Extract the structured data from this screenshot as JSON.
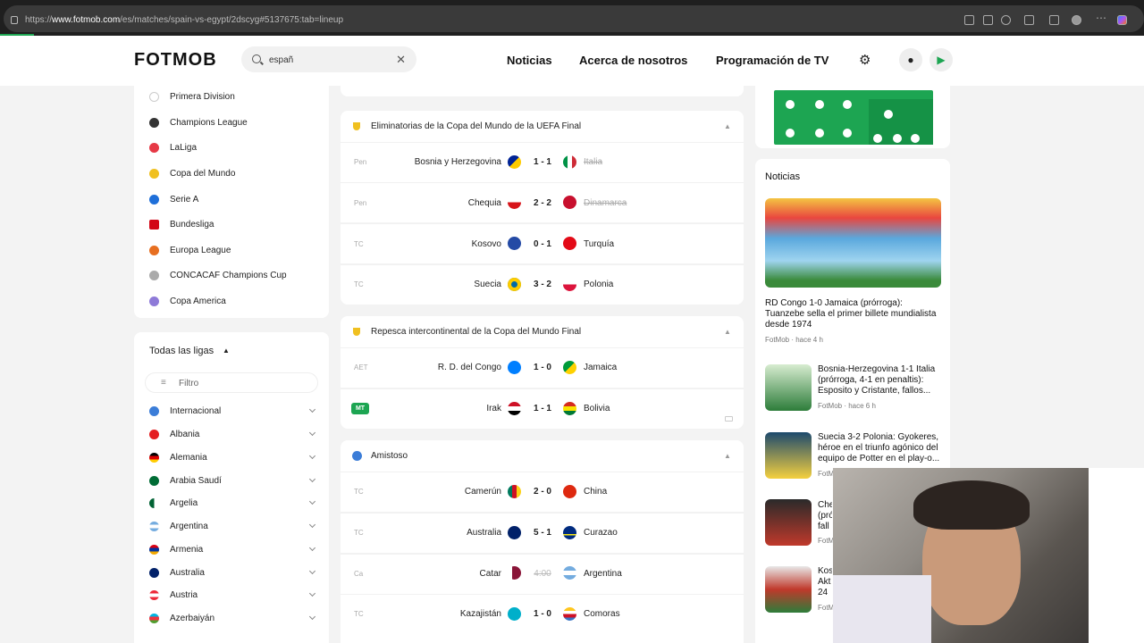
{
  "browser": {
    "url_prefix": "https://",
    "url_domain": "www.fotmob.com",
    "url_path": "/es/matches/spain-vs-egypt/2dscyg#5137675:tab=lineup"
  },
  "header": {
    "logo": "FOTMOB",
    "search_value": "españ",
    "nav": [
      "Noticias",
      "Acerca de nosotros",
      "Programación de TV"
    ]
  },
  "sidebar": {
    "leagues": [
      "Primera Division",
      "Champions League",
      "LaLiga",
      "Copa del Mundo",
      "Serie A",
      "Bundesliga",
      "Europa League",
      "CONCACAF Champions Cup",
      "Copa America"
    ],
    "all_title": "Todas las ligas",
    "filter_placeholder": "Filtro",
    "countries": [
      "Internacional",
      "Albania",
      "Alemania",
      "Arabia Saudí",
      "Argelia",
      "Argentina",
      "Armenia",
      "Australia",
      "Austria",
      "Azerbaiyán"
    ]
  },
  "sections": [
    {
      "title": "Eliminatorias de la Copa del Mundo de la UEFA Final",
      "matches": [
        {
          "status": "Pen",
          "home": "Bosnia y Herzegovina",
          "score": "1 - 1",
          "away": "Italia",
          "away_loser": true
        },
        {
          "status": "Pen",
          "home": "Chequia",
          "score": "2 - 2",
          "away": "Dinamarca",
          "away_loser": true
        },
        {
          "status": "TC",
          "home": "Kosovo",
          "score": "0 - 1",
          "away": "Turquía"
        },
        {
          "status": "TC",
          "home": "Suecia",
          "score": "3 - 2",
          "away": "Polonia"
        }
      ]
    },
    {
      "title": "Repesca intercontinental de la Copa del Mundo Final",
      "matches": [
        {
          "status": "AET",
          "home": "R. D. del Congo",
          "score": "1 - 0",
          "away": "Jamaica"
        },
        {
          "status": "MT",
          "home": "Irak",
          "score": "1 - 1",
          "away": "Bolivia",
          "live": true
        }
      ]
    },
    {
      "title": "Amistoso",
      "matches": [
        {
          "status": "TC",
          "home": "Camerún",
          "score": "2 - 0",
          "away": "China"
        },
        {
          "status": "TC",
          "home": "Australia",
          "score": "5 - 1",
          "away": "Curazao"
        },
        {
          "status": "Ca",
          "home": "Catar",
          "score": "4:00",
          "away": "Argentina",
          "cancelled": true
        },
        {
          "status": "TC",
          "home": "Kazajistán",
          "score": "1 - 0",
          "away": "Comoras"
        }
      ]
    }
  ],
  "news": {
    "heading": "Noticias",
    "featured_title": "RD Congo 1-0 Jamaica (prórroga): Tuanzebe sella el primer billete mundialista desde 1974",
    "featured_meta": "FotMob · hace 4 h",
    "items": [
      {
        "title": "Bosnia-Herzegovina 1-1 Italia (prórroga, 4-1 en penaltis): Esposito y Cristante, fallos...",
        "meta": "FotMob · hace 6 h"
      },
      {
        "title": "Suecia 3-2 Polonia: Gyokeres, héroe en el triunfo agónico del equipo de Potter en el play-o...",
        "meta": "FotM"
      },
      {
        "title": "Che (pró fall",
        "meta": "FotM"
      },
      {
        "title": "Kos Akt 24 a",
        "meta": "FotM"
      }
    ]
  },
  "colors": {
    "accent": "#1da552",
    "brand": "#111111"
  }
}
